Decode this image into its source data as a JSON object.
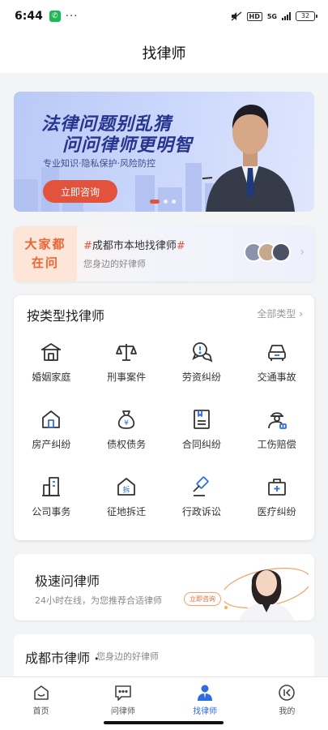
{
  "status": {
    "time": "6:44",
    "network": "5G",
    "battery": "32",
    "hd": "HD"
  },
  "nav": {
    "title": "找律师"
  },
  "banner": {
    "title_line1": "法律问题别乱猜",
    "title_line2": "问问律师更明智",
    "subtitle": "专业知识·隐私保护·风险防控",
    "button": "立即咨询",
    "slides": 3,
    "active_slide": 1
  },
  "promo": {
    "badge_line1": "大家都",
    "badge_line2": "在问",
    "hash_open": "#",
    "title": "成都市本地找律师",
    "hash_close": "#",
    "subtitle": "您身边的好律师"
  },
  "categories": {
    "heading": "按类型找律师",
    "all_label": "全部类型",
    "items": [
      {
        "label": "婚姻家庭",
        "icon": "house-heart-icon"
      },
      {
        "label": "刑事案件",
        "icon": "scales-icon"
      },
      {
        "label": "劳资纠纷",
        "icon": "chat-alert-icon"
      },
      {
        "label": "交通事故",
        "icon": "car-icon"
      },
      {
        "label": "房产纠纷",
        "icon": "home-icon"
      },
      {
        "label": "债权债务",
        "icon": "money-bag-icon"
      },
      {
        "label": "合同纠纷",
        "icon": "contract-icon"
      },
      {
        "label": "工伤赔偿",
        "icon": "worker-icon"
      },
      {
        "label": "公司事务",
        "icon": "building-icon"
      },
      {
        "label": "征地拆迁",
        "icon": "demolish-house-icon"
      },
      {
        "label": "行政诉讼",
        "icon": "gavel-icon"
      },
      {
        "label": "医疗纠纷",
        "icon": "medical-box-icon"
      }
    ]
  },
  "quick_ask": {
    "title": "极速问律师",
    "subtitle": "24小时在线，为您推荐合适律师",
    "button": "立即咨询"
  },
  "local_lawyers": {
    "title": "成都市律师",
    "dot": "•",
    "subtitle": "您身边的好律师"
  },
  "tabs": [
    {
      "label": "首页",
      "icon": "home-smile-icon",
      "active": false
    },
    {
      "label": "问律师",
      "icon": "chat-dots-icon",
      "active": false
    },
    {
      "label": "找律师",
      "icon": "lawyer-person-icon",
      "active": true
    },
    {
      "label": "我的",
      "icon": "profile-circle-icon",
      "active": false
    }
  ],
  "colors": {
    "accent": "#2f6de1",
    "brand_red": "#e2533e",
    "promo_orange": "#ec6433"
  }
}
